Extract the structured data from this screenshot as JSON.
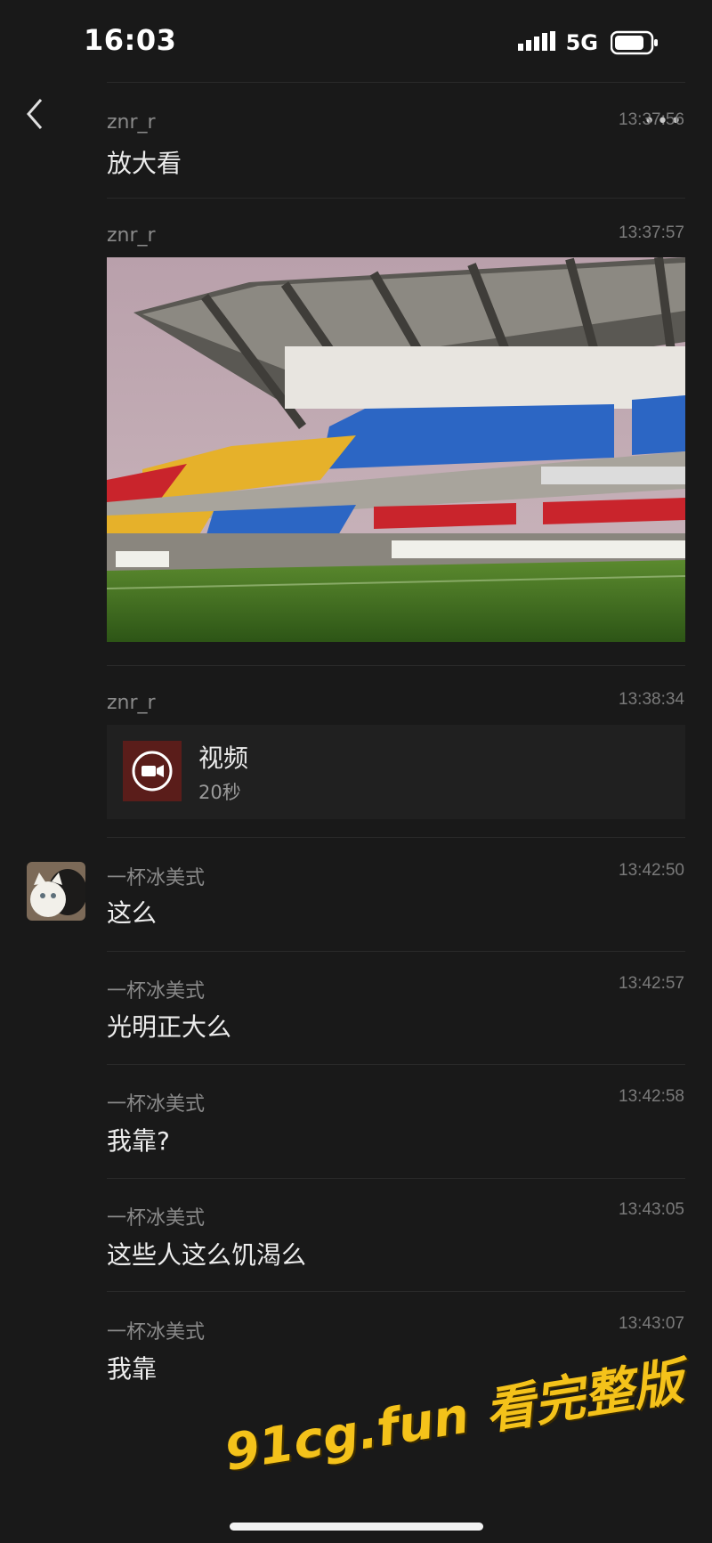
{
  "status_bar": {
    "time": "16:03",
    "network": "5G"
  },
  "header": {
    "back_icon": "chevron-left-icon",
    "more_icon": "more-dots-icon"
  },
  "messages": [
    {
      "sender": "znr_r",
      "time": "13:37:56",
      "type": "text",
      "text": "放大看"
    },
    {
      "sender": "znr_r",
      "time": "13:37:57",
      "type": "image"
    },
    {
      "sender": "znr_r",
      "time": "13:38:34",
      "type": "video",
      "video_title": "视频",
      "video_duration": "20秒"
    },
    {
      "sender": "一杯冰美式",
      "time": "13:42:50",
      "type": "text",
      "text": "这么"
    },
    {
      "sender": "一杯冰美式",
      "time": "13:42:57",
      "type": "text",
      "text": "光明正大么"
    },
    {
      "sender": "一杯冰美式",
      "time": "13:42:58",
      "type": "text",
      "text": "我靠?"
    },
    {
      "sender": "一杯冰美式",
      "time": "13:43:05",
      "type": "text",
      "text": "这些人这么饥渴么"
    },
    {
      "sender": "一杯冰美式",
      "time": "13:43:07",
      "type": "text",
      "text": "我靠"
    }
  ],
  "watermark": "91cg.fun 看完整版",
  "colors": {
    "background": "#191919",
    "watermark": "#f4c21a",
    "seat_red": "#c9242c",
    "seat_yellow": "#e6b12a",
    "seat_blue": "#2c66c4"
  }
}
